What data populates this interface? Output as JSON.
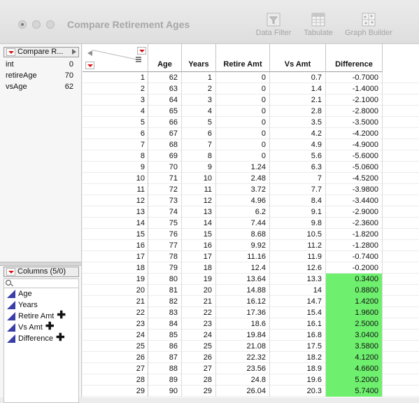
{
  "window": {
    "title": "Compare Retirement Ages"
  },
  "toolbar": {
    "data_filter": "Data Filter",
    "tabulate": "Tabulate",
    "graph_builder": "Graph Builder"
  },
  "table_panel": {
    "title": "Compare R...",
    "variables": [
      {
        "name": "int",
        "value": "0"
      },
      {
        "name": "retireAge",
        "value": "70"
      },
      {
        "name": "vsAge",
        "value": "62"
      }
    ]
  },
  "columns_panel": {
    "title": "Columns (5/0)",
    "items": [
      {
        "name": "Age",
        "formula": ""
      },
      {
        "name": "Years",
        "formula": ""
      },
      {
        "name": "Retire Amt",
        "formula": "✚"
      },
      {
        "name": "Vs Amt",
        "formula": "✚"
      },
      {
        "name": "Difference",
        "formula": "✚"
      }
    ]
  },
  "grid": {
    "headers": [
      "Age",
      "Years",
      "Retire Amt",
      "Vs Amt",
      "Difference"
    ],
    "highlight_color": "#6ef06e",
    "rows": [
      [
        "1",
        "62",
        "1",
        "0",
        "0.7",
        "-0.7000"
      ],
      [
        "2",
        "63",
        "2",
        "0",
        "1.4",
        "-1.4000"
      ],
      [
        "3",
        "64",
        "3",
        "0",
        "2.1",
        "-2.1000"
      ],
      [
        "4",
        "65",
        "4",
        "0",
        "2.8",
        "-2.8000"
      ],
      [
        "5",
        "66",
        "5",
        "0",
        "3.5",
        "-3.5000"
      ],
      [
        "6",
        "67",
        "6",
        "0",
        "4.2",
        "-4.2000"
      ],
      [
        "7",
        "68",
        "7",
        "0",
        "4.9",
        "-4.9000"
      ],
      [
        "8",
        "69",
        "8",
        "0",
        "5.6",
        "-5.6000"
      ],
      [
        "9",
        "70",
        "9",
        "1.24",
        "6.3",
        "-5.0600"
      ],
      [
        "10",
        "71",
        "10",
        "2.48",
        "7",
        "-4.5200"
      ],
      [
        "11",
        "72",
        "11",
        "3.72",
        "7.7",
        "-3.9800"
      ],
      [
        "12",
        "73",
        "12",
        "4.96",
        "8.4",
        "-3.4400"
      ],
      [
        "13",
        "74",
        "13",
        "6.2",
        "9.1",
        "-2.9000"
      ],
      [
        "14",
        "75",
        "14",
        "7.44",
        "9.8",
        "-2.3600"
      ],
      [
        "15",
        "76",
        "15",
        "8.68",
        "10.5",
        "-1.8200"
      ],
      [
        "16",
        "77",
        "16",
        "9.92",
        "11.2",
        "-1.2800"
      ],
      [
        "17",
        "78",
        "17",
        "11.16",
        "11.9",
        "-0.7400"
      ],
      [
        "18",
        "79",
        "18",
        "12.4",
        "12.6",
        "-0.2000"
      ],
      [
        "19",
        "80",
        "19",
        "13.64",
        "13.3",
        "0.3400"
      ],
      [
        "20",
        "81",
        "20",
        "14.88",
        "14",
        "0.8800"
      ],
      [
        "21",
        "82",
        "21",
        "16.12",
        "14.7",
        "1.4200"
      ],
      [
        "22",
        "83",
        "22",
        "17.36",
        "15.4",
        "1.9600"
      ],
      [
        "23",
        "84",
        "23",
        "18.6",
        "16.1",
        "2.5000"
      ],
      [
        "24",
        "85",
        "24",
        "19.84",
        "16.8",
        "3.0400"
      ],
      [
        "25",
        "86",
        "25",
        "21.08",
        "17.5",
        "3.5800"
      ],
      [
        "26",
        "87",
        "26",
        "22.32",
        "18.2",
        "4.1200"
      ],
      [
        "27",
        "88",
        "27",
        "23.56",
        "18.9",
        "4.6600"
      ],
      [
        "28",
        "89",
        "28",
        "24.8",
        "19.6",
        "5.2000"
      ],
      [
        "29",
        "90",
        "29",
        "26.04",
        "20.3",
        "5.7400"
      ]
    ]
  }
}
